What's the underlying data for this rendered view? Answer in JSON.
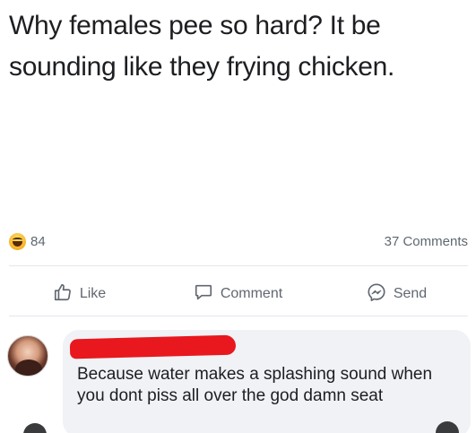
{
  "post": {
    "text": "Why females pee so hard? It be sounding like they frying chicken."
  },
  "stats": {
    "reaction_count": "84",
    "comments_count": "37 Comments"
  },
  "actions": {
    "like_label": "Like",
    "comment_label": "Comment",
    "send_label": "Send"
  },
  "comment": {
    "text": "Because water makes a splashing sound when you dont piss all over the god damn seat"
  },
  "colors": {
    "redaction": "#e8181e",
    "bubble": "#f0f2f5",
    "muted_text": "#606770"
  }
}
